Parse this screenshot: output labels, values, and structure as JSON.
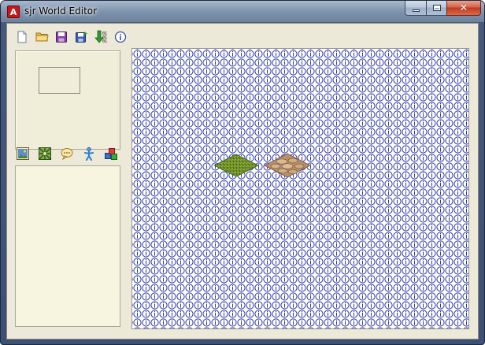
{
  "window": {
    "title": "sjr World Editor",
    "app_icon_glyph": "A",
    "caption_buttons": {
      "minimize_icon": "minimize-icon",
      "maximize_icon": "maximize-icon",
      "close_icon": "close-icon",
      "close_glyph": "✕"
    }
  },
  "toolbar": {
    "buttons": [
      {
        "name": "new-file",
        "icon": "new-file-icon"
      },
      {
        "name": "open-folder",
        "icon": "open-folder-icon"
      },
      {
        "name": "save",
        "icon": "save-icon"
      },
      {
        "name": "save-as",
        "icon": "save-as-icon"
      },
      {
        "name": "export-binary",
        "icon": "export-binary-icon"
      },
      {
        "name": "info",
        "icon": "info-icon"
      }
    ]
  },
  "palette": {
    "buttons": [
      {
        "name": "tile-picture",
        "icon": "tile-picture-icon"
      },
      {
        "name": "terrain-map",
        "icon": "terrain-map-icon"
      },
      {
        "name": "dialog-speech",
        "icon": "speech-bubble-icon"
      },
      {
        "name": "character",
        "icon": "character-icon"
      },
      {
        "name": "objects",
        "icon": "objects-shapes-icon"
      }
    ]
  },
  "map": {
    "empty_tile_icon": "info-circle-icon",
    "placed_tiles": [
      {
        "name": "grass-tile",
        "icon": "grass-tile-icon",
        "color": "#6f8f2a"
      },
      {
        "name": "stone-tile",
        "icon": "stone-tile-icon",
        "color": "#c9a47a"
      }
    ]
  },
  "colors": {
    "client_bg": "#ece9d8",
    "title_bar": "#8fa2bb",
    "tile_outline": "#2d3aa8",
    "close_button": "#c1391e"
  }
}
